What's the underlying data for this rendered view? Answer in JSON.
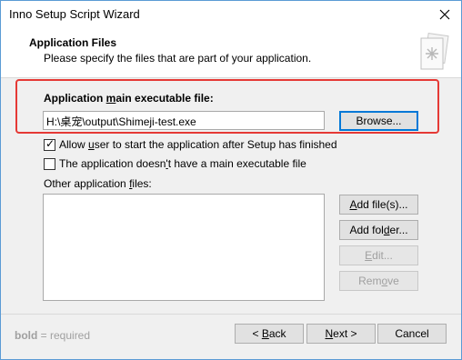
{
  "window": {
    "title": "Inno Setup Script Wizard"
  },
  "header": {
    "title": "Application Files",
    "subtitle": "Please specify the files that are part of your application."
  },
  "main_exe": {
    "label_pre": "Application ",
    "label_u": "m",
    "label_post": "ain executable file:",
    "value": "H:\\桌宠\\output\\Shimeji-test.exe",
    "browse_label": "Browse..."
  },
  "options": {
    "allow_start": {
      "pre": "Allow ",
      "u": "u",
      "post": "ser to start the application after Setup has finished",
      "checked": true
    },
    "no_exe": {
      "pre": "The application doesn",
      "u": "'",
      "post": "t have a main executable file",
      "checked": false
    }
  },
  "other_files": {
    "label_pre": "Other application ",
    "label_u": "f",
    "label_post": "iles:",
    "add_files": {
      "u": "A",
      "post": "dd file(s)..."
    },
    "add_folder": {
      "pre": "Add fol",
      "u": "d",
      "post": "er..."
    },
    "edit": {
      "u": "E",
      "post": "dit..."
    },
    "remove": {
      "pre": "Rem",
      "u": "o",
      "post": "ve"
    }
  },
  "footer": {
    "bold_word": "bold",
    "note_rest": " = required",
    "back": {
      "pre": "< ",
      "u": "B",
      "post": "ack"
    },
    "next": {
      "u": "N",
      "post": "ext >"
    },
    "cancel": "Cancel"
  },
  "colors": {
    "highlight": "#e53935",
    "focus": "#0078d7"
  }
}
